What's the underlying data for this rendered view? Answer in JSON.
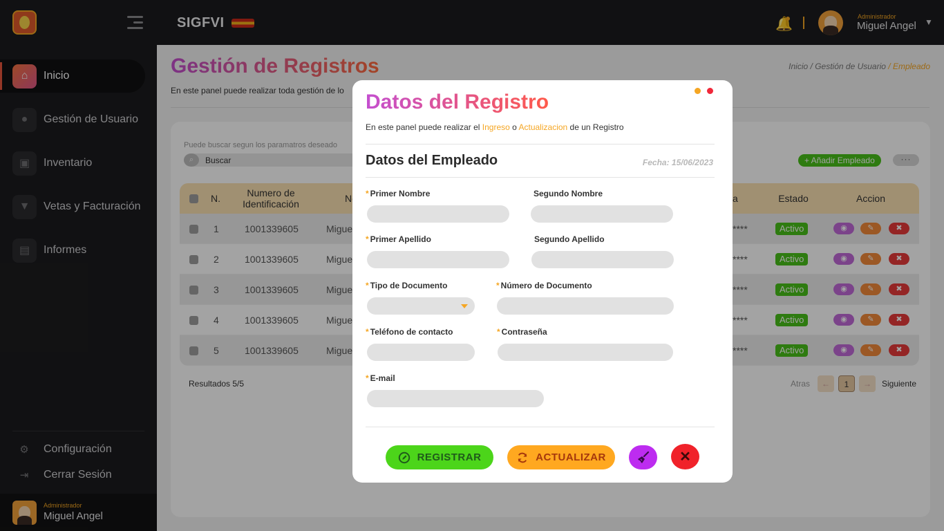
{
  "app": {
    "brand": "SIGFVI"
  },
  "user": {
    "role": "Administrador",
    "name": "Miguel Angel"
  },
  "sidebar": {
    "items": [
      {
        "label": "Inicio",
        "icon": "home-icon",
        "active": true
      },
      {
        "label": "Gestión de Usuario",
        "icon": "user-icon",
        "active": false
      },
      {
        "label": "Inventario",
        "icon": "box-icon",
        "active": false
      },
      {
        "label": "Vetas y Facturación",
        "icon": "cart-icon",
        "active": false
      },
      {
        "label": "Informes",
        "icon": "report-icon",
        "active": false
      }
    ],
    "config_label": "Configuración",
    "logout_label": "Cerrar Sesión"
  },
  "page": {
    "title": "Gestión de Registros",
    "description": "En este panel puede realizar toda gestión de lo",
    "breadcrumb": {
      "part1": "Inicio",
      "sep": " / ",
      "part2": "Gestión de Usuario",
      "current": "Empleado"
    }
  },
  "list": {
    "search_hint": "Puede buscar segun los paramatros deseado",
    "search_placeholder": "Buscar",
    "add_button": "+ Añadir Empleado",
    "more_button": "···",
    "columns": [
      "N.",
      "Numero de Identificación",
      "No",
      "ña",
      "Estado",
      "Accion"
    ],
    "rows": [
      {
        "n": "1",
        "id": "1001339605",
        "name": "Migue",
        "pass": "****",
        "estado": "Activo"
      },
      {
        "n": "2",
        "id": "1001339605",
        "name": "Migue",
        "pass": "****",
        "estado": "Activo"
      },
      {
        "n": "3",
        "id": "1001339605",
        "name": "Migue",
        "pass": "****",
        "estado": "Activo"
      },
      {
        "n": "4",
        "id": "1001339605",
        "name": "Migue",
        "pass": "****",
        "estado": "Activo"
      },
      {
        "n": "5",
        "id": "1001339605",
        "name": "Migue",
        "pass": "****",
        "estado": "Activo"
      }
    ],
    "results": "Resultados 5/5",
    "pager": {
      "prev": "Atras",
      "page": "1",
      "next": "Siguiente"
    }
  },
  "modal": {
    "title": "Datos del Registro",
    "desc_pre": "En este panel puede realizar el ",
    "desc_hl1": "Ingreso",
    "desc_mid": " o ",
    "desc_hl2": "Actualizacion",
    "desc_post": " de un Registro",
    "section": "Datos del Empleado",
    "date": "Fecha: 15/06/2023",
    "fields": {
      "primer_nombre": "Primer Nombre",
      "segundo_nombre": "Segundo Nombre",
      "primer_apellido": "Primer Apellido",
      "segundo_apellido": "Segundo Apellido",
      "tipo_documento": "Tipo de Documento",
      "numero_documento": "Número de Documento",
      "telefono": "Teléfono de contacto",
      "contrasena": "Contraseña",
      "email": "E-mail"
    },
    "required_mark": "*",
    "buttons": {
      "register": "REGISTRAR",
      "update": "ACTUALIZAR"
    }
  },
  "colors": {
    "accent": "#f5a623",
    "success": "#49c11a",
    "danger": "#f0222a",
    "purple": "#bd2cf0"
  }
}
